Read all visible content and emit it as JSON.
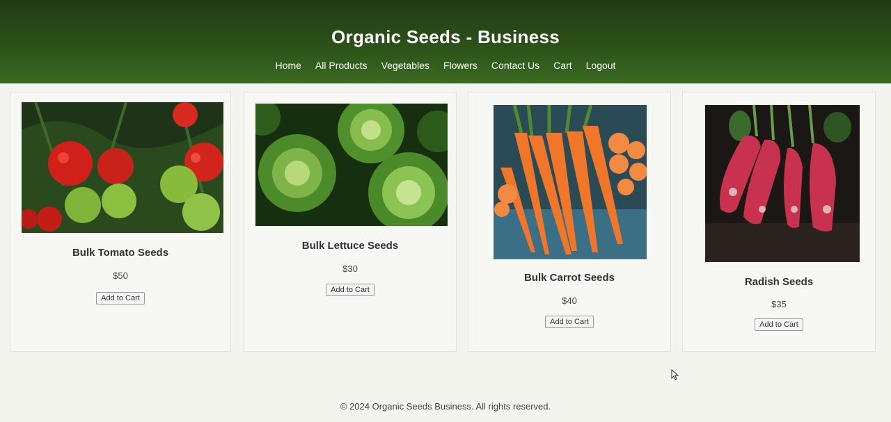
{
  "header": {
    "title": "Organic Seeds - Business",
    "nav": [
      "Home",
      "All Products",
      "Vegetables",
      "Flowers",
      "Contact Us",
      "Cart",
      "Logout"
    ]
  },
  "products": [
    {
      "name": "Bulk Tomato Seeds",
      "price": "$50",
      "button": "Add to Cart"
    },
    {
      "name": "Bulk Lettuce Seeds",
      "price": "$30",
      "button": "Add to Cart"
    },
    {
      "name": "Bulk Carrot Seeds",
      "price": "$40",
      "button": "Add to Cart"
    },
    {
      "name": "Radish Seeds",
      "price": "$35",
      "button": "Add to Cart"
    }
  ],
  "footer": {
    "text": "© 2024 Organic Seeds Business. All rights reserved."
  }
}
